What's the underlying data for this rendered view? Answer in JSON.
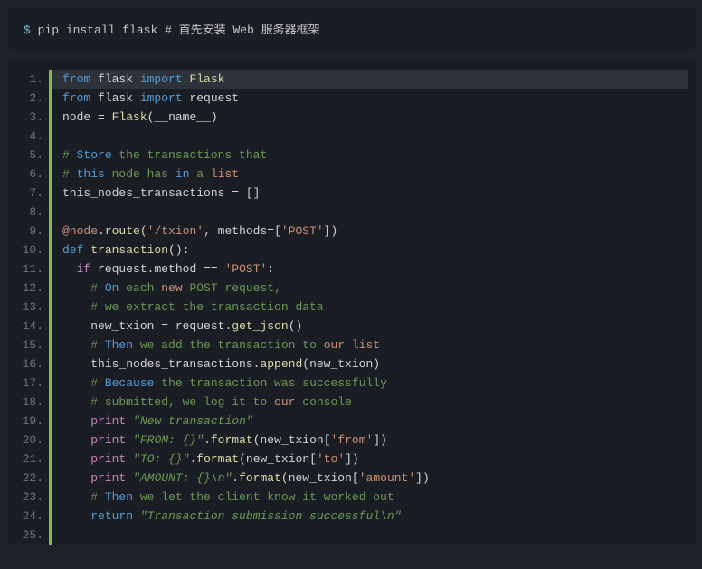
{
  "shell": {
    "prompt": "$",
    "command": "pip install flask",
    "comment": "# 首先安装 Web 服务器框架"
  },
  "code": {
    "lines": [
      {
        "n": 1,
        "hl": true,
        "tokens": [
          [
            "kw",
            "from"
          ],
          [
            "name",
            " flask "
          ],
          [
            "kw",
            "import"
          ],
          [
            "name",
            " "
          ],
          [
            "fn",
            "Flask"
          ]
        ]
      },
      {
        "n": 2,
        "tokens": [
          [
            "kw",
            "from"
          ],
          [
            "name",
            " flask "
          ],
          [
            "kw",
            "import"
          ],
          [
            "name",
            " request"
          ]
        ]
      },
      {
        "n": 3,
        "tokens": [
          [
            "name",
            "node "
          ],
          [
            "op",
            "="
          ],
          [
            "name",
            " "
          ],
          [
            "fn",
            "Flask"
          ],
          [
            "op",
            "("
          ],
          [
            "name",
            "__name__"
          ],
          [
            "op",
            ")"
          ]
        ]
      },
      {
        "n": 4,
        "tokens": []
      },
      {
        "n": 5,
        "tokens": [
          [
            "com",
            "# "
          ],
          [
            "comkw",
            "Store"
          ],
          [
            "com",
            " the transactions that"
          ]
        ]
      },
      {
        "n": 6,
        "tokens": [
          [
            "com",
            "# "
          ],
          [
            "comkw",
            "this"
          ],
          [
            "com",
            " node has "
          ],
          [
            "comkw",
            "in"
          ],
          [
            "com",
            " a "
          ],
          [
            "comor",
            "list"
          ]
        ]
      },
      {
        "n": 7,
        "tokens": [
          [
            "name",
            "this_nodes_transactions "
          ],
          [
            "op",
            "="
          ],
          [
            "name",
            " "
          ],
          [
            "op",
            "[]"
          ]
        ]
      },
      {
        "n": 8,
        "tokens": []
      },
      {
        "n": 9,
        "tokens": [
          [
            "at",
            "@node"
          ],
          [
            "op",
            "."
          ],
          [
            "fn",
            "route"
          ],
          [
            "op",
            "("
          ],
          [
            "str",
            "'/txion'"
          ],
          [
            "op",
            ", methods"
          ],
          [
            "op",
            "=["
          ],
          [
            "str",
            "'POST'"
          ],
          [
            "op",
            "])"
          ]
        ]
      },
      {
        "n": 10,
        "tokens": [
          [
            "kw",
            "def"
          ],
          [
            "name",
            " "
          ],
          [
            "fn",
            "transaction"
          ],
          [
            "op",
            "():"
          ]
        ]
      },
      {
        "n": 11,
        "tokens": [
          [
            "name",
            "  "
          ],
          [
            "kw2",
            "if"
          ],
          [
            "name",
            " request"
          ],
          [
            "op",
            "."
          ],
          [
            "name",
            "method "
          ],
          [
            "op",
            "=="
          ],
          [
            "name",
            " "
          ],
          [
            "str",
            "'POST'"
          ],
          [
            "op",
            ":"
          ]
        ]
      },
      {
        "n": 12,
        "tokens": [
          [
            "name",
            "    "
          ],
          [
            "com",
            "# "
          ],
          [
            "comkw",
            "On"
          ],
          [
            "com",
            " each "
          ],
          [
            "comor",
            "new"
          ],
          [
            "com",
            " POST request,"
          ]
        ]
      },
      {
        "n": 13,
        "tokens": [
          [
            "name",
            "    "
          ],
          [
            "com",
            "# we extract the transaction data"
          ]
        ]
      },
      {
        "n": 14,
        "tokens": [
          [
            "name",
            "    new_txion "
          ],
          [
            "op",
            "="
          ],
          [
            "name",
            " request"
          ],
          [
            "op",
            "."
          ],
          [
            "fn",
            "get_json"
          ],
          [
            "op",
            "()"
          ]
        ]
      },
      {
        "n": 15,
        "tokens": [
          [
            "name",
            "    "
          ],
          [
            "com",
            "# "
          ],
          [
            "comkw",
            "Then"
          ],
          [
            "com",
            " we add the transaction to "
          ],
          [
            "comor",
            "our"
          ],
          [
            "com",
            " "
          ],
          [
            "comor",
            "list"
          ]
        ]
      },
      {
        "n": 16,
        "tokens": [
          [
            "name",
            "    this_nodes_transactions"
          ],
          [
            "op",
            "."
          ],
          [
            "fn",
            "append"
          ],
          [
            "op",
            "("
          ],
          [
            "name",
            "new_txion"
          ],
          [
            "op",
            ")"
          ]
        ]
      },
      {
        "n": 17,
        "tokens": [
          [
            "name",
            "    "
          ],
          [
            "com",
            "# "
          ],
          [
            "comkw",
            "Because"
          ],
          [
            "com",
            " the transaction was successfully"
          ]
        ]
      },
      {
        "n": 18,
        "tokens": [
          [
            "name",
            "    "
          ],
          [
            "com",
            "# submitted, we log it to "
          ],
          [
            "comor",
            "our"
          ],
          [
            "com",
            " console"
          ]
        ]
      },
      {
        "n": 19,
        "tokens": [
          [
            "name",
            "    "
          ],
          [
            "print",
            "print"
          ],
          [
            "name",
            " "
          ],
          [
            "str2",
            "\"New transaction\""
          ]
        ]
      },
      {
        "n": 20,
        "tokens": [
          [
            "name",
            "    "
          ],
          [
            "print",
            "print"
          ],
          [
            "name",
            " "
          ],
          [
            "str2",
            "\"FROM: {}\""
          ],
          [
            "op",
            "."
          ],
          [
            "fn",
            "format"
          ],
          [
            "op",
            "("
          ],
          [
            "name",
            "new_txion"
          ],
          [
            "op",
            "["
          ],
          [
            "str",
            "'from'"
          ],
          [
            "op",
            "])"
          ]
        ]
      },
      {
        "n": 21,
        "tokens": [
          [
            "name",
            "    "
          ],
          [
            "print",
            "print"
          ],
          [
            "name",
            " "
          ],
          [
            "str2",
            "\"TO: {}\""
          ],
          [
            "op",
            "."
          ],
          [
            "fn",
            "format"
          ],
          [
            "op",
            "("
          ],
          [
            "name",
            "new_txion"
          ],
          [
            "op",
            "["
          ],
          [
            "str",
            "'to'"
          ],
          [
            "op",
            "])"
          ]
        ]
      },
      {
        "n": 22,
        "tokens": [
          [
            "name",
            "    "
          ],
          [
            "print",
            "print"
          ],
          [
            "name",
            " "
          ],
          [
            "str2",
            "\"AMOUNT: {}\\n\""
          ],
          [
            "op",
            "."
          ],
          [
            "fn",
            "format"
          ],
          [
            "op",
            "("
          ],
          [
            "name",
            "new_txion"
          ],
          [
            "op",
            "["
          ],
          [
            "str",
            "'amount'"
          ],
          [
            "op",
            "])"
          ]
        ]
      },
      {
        "n": 23,
        "tokens": [
          [
            "name",
            "    "
          ],
          [
            "com",
            "# "
          ],
          [
            "comkw",
            "Then"
          ],
          [
            "com",
            " we let the client know it worked out"
          ]
        ]
      },
      {
        "n": 24,
        "tokens": [
          [
            "name",
            "    "
          ],
          [
            "kw",
            "return"
          ],
          [
            "name",
            " "
          ],
          [
            "str2",
            "\"Transaction submission successful\\n\""
          ]
        ]
      },
      {
        "n": 25,
        "tokens": []
      }
    ]
  }
}
